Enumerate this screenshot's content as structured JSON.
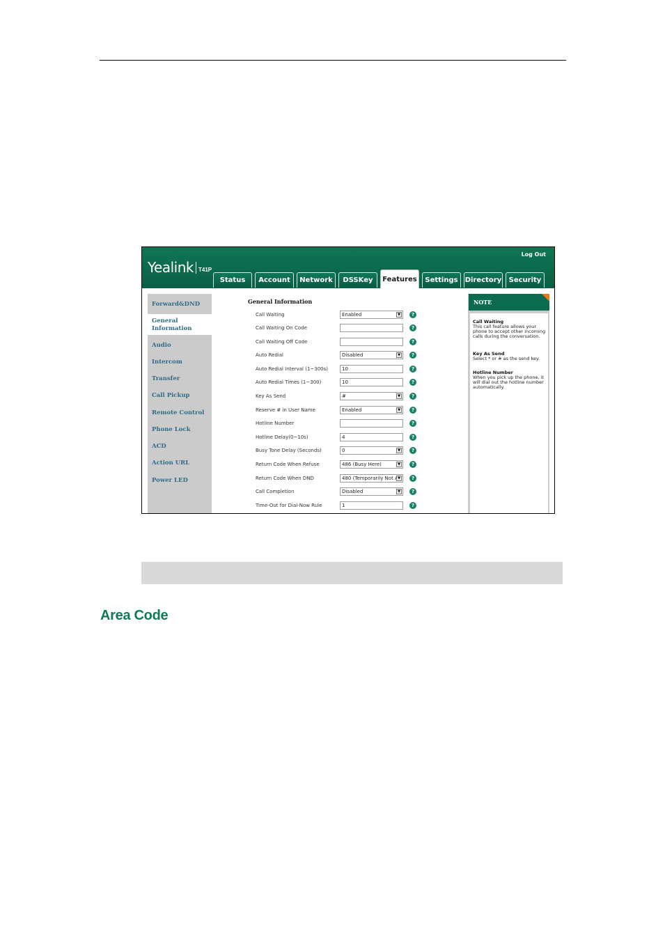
{
  "header": {
    "logo_text": "Yealink",
    "model": "T41P",
    "logout_label": "Log Out"
  },
  "tabs": [
    "Status",
    "Account",
    "Network",
    "DSSKey",
    "Features",
    "Settings",
    "Directory",
    "Security"
  ],
  "active_tab": "Features",
  "sidebar": [
    "Forward&DND",
    "General Information",
    "Audio",
    "Intercom",
    "Transfer",
    "Call Pickup",
    "Remote Control",
    "Phone Lock",
    "ACD",
    "Action URL",
    "Power LED"
  ],
  "sidebar_active": "General Information",
  "form": {
    "section_title": "General Information",
    "rows": [
      {
        "label": "Call Waiting",
        "value": "Enabled",
        "type": "select"
      },
      {
        "label": "Call Waiting On Code",
        "value": "",
        "type": "input"
      },
      {
        "label": "Call Waiting Off Code",
        "value": "",
        "type": "input"
      },
      {
        "label": "Auto Redial",
        "value": "Disabled",
        "type": "select"
      },
      {
        "label": "Auto Redial Interval (1~300s)",
        "value": "10",
        "type": "input"
      },
      {
        "label": "Auto Redial Times (1~300)",
        "value": "10",
        "type": "input"
      },
      {
        "label": "Key As Send",
        "value": "#",
        "type": "select"
      },
      {
        "label": "Reserve # in User Name",
        "value": "Enabled",
        "type": "select"
      },
      {
        "label": "Hotline Number",
        "value": "",
        "type": "input"
      },
      {
        "label": "Hotline Delay(0~10s)",
        "value": "4",
        "type": "input"
      },
      {
        "label": "Busy Tone Delay (Seconds)",
        "value": "0",
        "type": "select"
      },
      {
        "label": "Return Code When Refuse",
        "value": "486 (Busy Here)",
        "type": "select"
      },
      {
        "label": "Return Code When DND",
        "value": "480 (Temporarily Not A",
        "type": "select"
      },
      {
        "label": "Call Completion",
        "value": "Disabled",
        "type": "select"
      },
      {
        "label": "Time-Out for Dial-Now Rule",
        "value": "1",
        "type": "input"
      }
    ]
  },
  "note": {
    "title": "NOTE",
    "items": [
      {
        "heading": "Call Waiting",
        "text": "This call feature allows your phone to accept other incoming calls during the conversation."
      },
      {
        "heading": "Key As Send",
        "text": "Select * or # as the send key."
      },
      {
        "heading": "Hotline Number",
        "text": "When you pick up the phone, it will dial out the hotline number automatically."
      }
    ]
  },
  "document": {
    "section_heading": "Area Code"
  },
  "colors": {
    "brand_green": "#0c6a4e",
    "heading_green": "#0e7a55",
    "note_corner": "#e87a1c",
    "sidebar_link": "#2f6b86"
  },
  "icons": {
    "help": "question-mark-circle-icon",
    "select": "dropdown-arrow-icon"
  }
}
